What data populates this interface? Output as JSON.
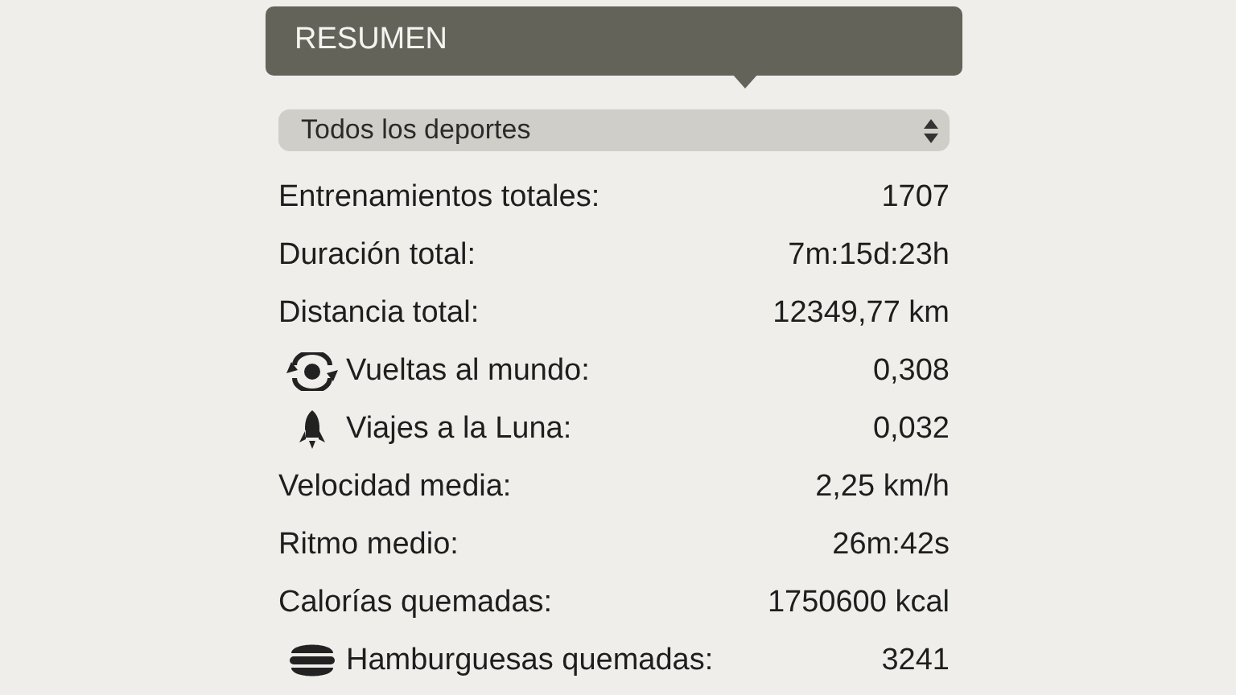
{
  "header": {
    "title": "RESUMEN"
  },
  "sport_select": {
    "value": "Todos los deportes"
  },
  "stats": [
    {
      "kind": "plain",
      "label": "Entrenamientos totales:",
      "value": "1707"
    },
    {
      "kind": "plain",
      "label": "Duración total:",
      "value": "7m:15d:23h"
    },
    {
      "kind": "plain",
      "label": "Distancia total:",
      "value": "12349,77 km"
    },
    {
      "kind": "globe",
      "label": "Vueltas al mundo:",
      "value": "0,308"
    },
    {
      "kind": "rocket",
      "label": "Viajes a la Luna:",
      "value": "0,032"
    },
    {
      "kind": "plain",
      "label": "Velocidad media:",
      "value": "2,25 km/h"
    },
    {
      "kind": "plain",
      "label": "Ritmo medio:",
      "value": "26m:42s"
    },
    {
      "kind": "plain",
      "label": "Calorías quemadas:",
      "value": "1750600 kcal"
    },
    {
      "kind": "burger",
      "label": "Hamburguesas quemadas:",
      "value": "3241"
    }
  ]
}
